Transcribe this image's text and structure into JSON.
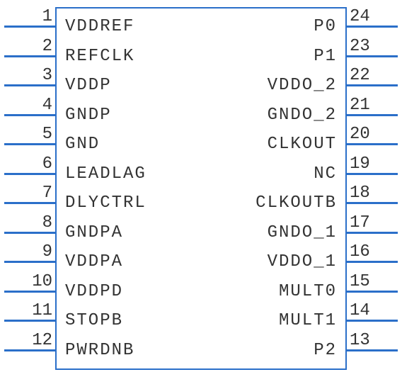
{
  "chip": {
    "left_pins": [
      {
        "num": "1",
        "label": "VDDREF"
      },
      {
        "num": "2",
        "label": "REFCLK"
      },
      {
        "num": "3",
        "label": "VDDP"
      },
      {
        "num": "4",
        "label": "GNDP"
      },
      {
        "num": "5",
        "label": "GND"
      },
      {
        "num": "6",
        "label": "LEADLAG"
      },
      {
        "num": "7",
        "label": "DLYCTRL"
      },
      {
        "num": "8",
        "label": "GNDPA"
      },
      {
        "num": "9",
        "label": "VDDPA"
      },
      {
        "num": "10",
        "label": "VDDPD"
      },
      {
        "num": "11",
        "label": "STOPB"
      },
      {
        "num": "12",
        "label": "PWRDNB"
      }
    ],
    "right_pins": [
      {
        "num": "24",
        "label": "P0"
      },
      {
        "num": "23",
        "label": "P1"
      },
      {
        "num": "22",
        "label": "VDDO_2"
      },
      {
        "num": "21",
        "label": "GNDO_2"
      },
      {
        "num": "20",
        "label": "CLKOUT"
      },
      {
        "num": "19",
        "label": "NC"
      },
      {
        "num": "18",
        "label": "CLKOUTB"
      },
      {
        "num": "17",
        "label": "GNDO_1"
      },
      {
        "num": "16",
        "label": "VDDO_1"
      },
      {
        "num": "15",
        "label": "MULT0"
      },
      {
        "num": "14",
        "label": "MULT1"
      },
      {
        "num": "13",
        "label": "P2"
      }
    ]
  }
}
